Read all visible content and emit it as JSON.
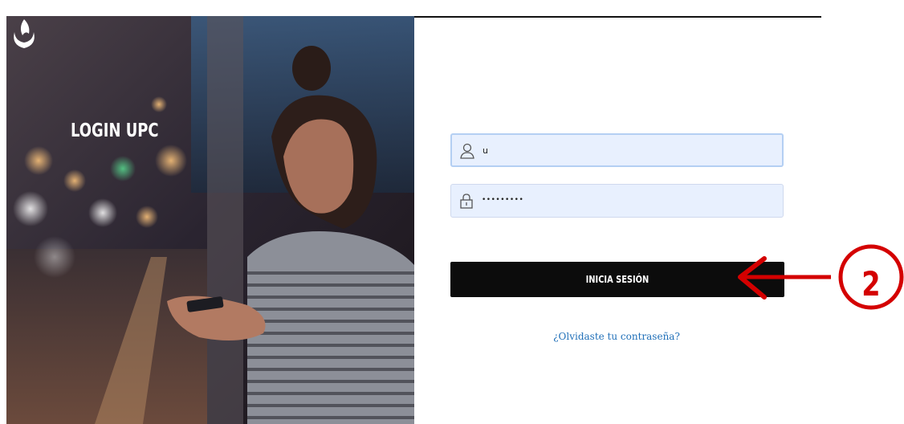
{
  "branding": {
    "title": "LOGIN UPC",
    "logo_icon": "upc-flame-logo"
  },
  "form": {
    "username": {
      "value": "u",
      "icon": "user-icon"
    },
    "password": {
      "value": "•••••••••",
      "icon": "lock-icon"
    },
    "submit_label": "INICIA SESIÓN",
    "forgot_label": "¿Olvidaste tu contraseña?"
  },
  "annotation": {
    "step": "2",
    "color": "#d40000"
  },
  "colors": {
    "input_bg": "#e8f0fe",
    "button_bg": "#0c0c0c",
    "link": "#1f6fb8"
  }
}
